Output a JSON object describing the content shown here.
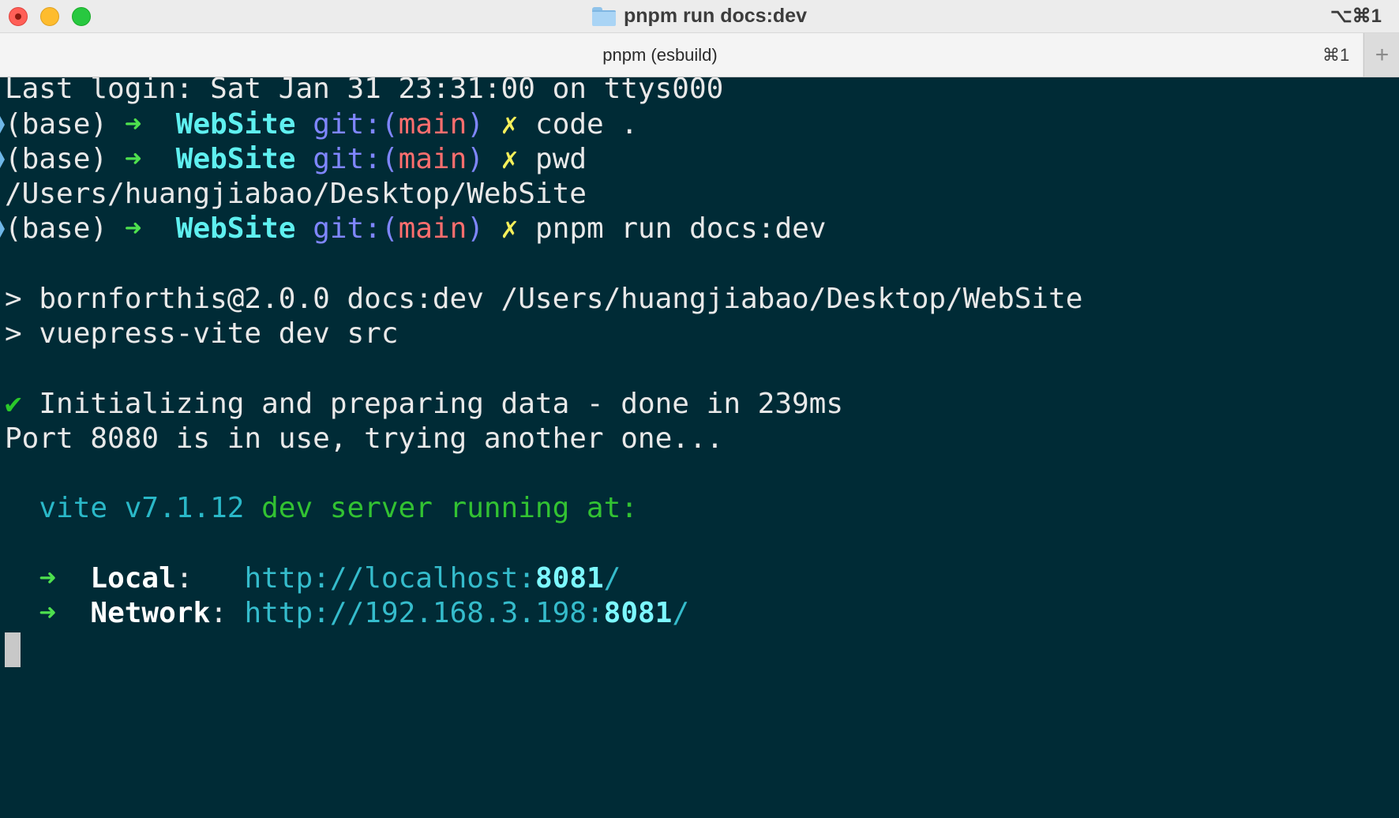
{
  "window": {
    "title": "pnpm run docs:dev",
    "title_shortcut": "⌥⌘1"
  },
  "tab": {
    "label": "pnpm (esbuild)",
    "shortcut": "⌘1",
    "new_tab": "+"
  },
  "terminal": {
    "last_login": "Last login: Sat Jan 31 23:31:00 on ttys000",
    "prompt": {
      "env": "(base)",
      "arrow": "➜",
      "dir": "WebSite",
      "git": "git:(",
      "branch": "main",
      "git_close": ")",
      "dirty": "✗"
    },
    "commands": [
      "code .",
      "pwd",
      "pnpm run docs:dev"
    ],
    "pwd_output": "/Users/huangjiabao/Desktop/WebSite",
    "script_line1": "> bornforthis@2.0.0 docs:dev /Users/huangjiabao/Desktop/WebSite",
    "script_line2": "> vuepress-vite dev src",
    "check": "✔",
    "init_msg": " Initializing and preparing data - done in 239ms",
    "port_msg": "Port 8080 is in use, trying another one...",
    "vite_version": "vite v7.1.12",
    "vite_msg": " dev server running at:",
    "local_label": "Local",
    "local_url_prefix": "http://localhost:",
    "local_port": "8081",
    "network_label": "Network",
    "network_url_prefix": "http://192.168.3.198:",
    "network_port": "8081",
    "url_suffix": "/",
    "colon": ":"
  },
  "colors": {
    "background": "#002b36",
    "prompt_arrow": "#4ee04e",
    "dir": "#5ff0f0",
    "git": "#7f86ff",
    "branch": "#ff6e6e",
    "dirty": "#f5f05a",
    "url": "#35bccc"
  },
  "icons": [
    "folder-icon",
    "close-icon",
    "minimize-icon",
    "zoom-icon",
    "plus-icon"
  ]
}
